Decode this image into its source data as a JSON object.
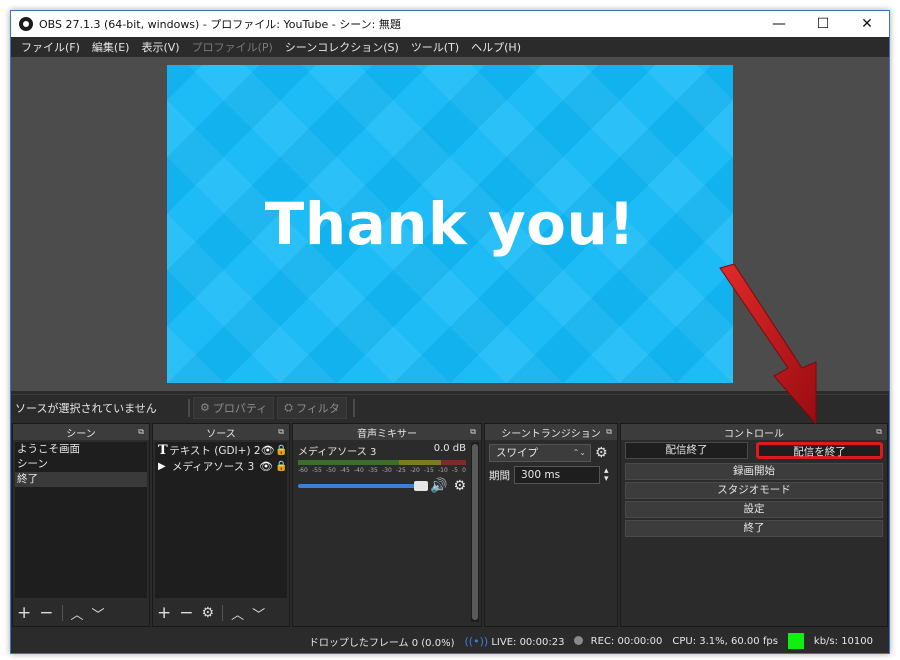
{
  "window": {
    "title": "OBS 27.1.3 (64-bit, windows) - プロファイル: YouTube - シーン: 無題",
    "controls": {
      "minimize": "—",
      "maximize": "☐",
      "close": "✕"
    }
  },
  "menu": [
    {
      "label": "ファイル(F)",
      "enabled": true
    },
    {
      "label": "編集(E)",
      "enabled": true
    },
    {
      "label": "表示(V)",
      "enabled": true
    },
    {
      "label": "プロファイル(P)",
      "enabled": false
    },
    {
      "label": "シーンコレクション(S)",
      "enabled": true
    },
    {
      "label": "ツール(T)",
      "enabled": true
    },
    {
      "label": "ヘルプ(H)",
      "enabled": true
    }
  ],
  "preview": {
    "text": "Thank you!",
    "background": "#12b8f7"
  },
  "source_toolbar": {
    "status": "ソースが選択されていません",
    "properties_label": "プロパティ",
    "filters_label": "フィルタ"
  },
  "scenes": {
    "title": "シーン",
    "items": [
      "ようこそ画面",
      "シーン",
      "終了"
    ],
    "selected_index": 2
  },
  "sources": {
    "title": "ソース",
    "items": [
      {
        "icon": "text-icon",
        "name": "テキスト (GDI+) 2"
      },
      {
        "icon": "media-icon",
        "name": "メディアソース 3"
      }
    ]
  },
  "mixer": {
    "title": "音声ミキサー",
    "channel": {
      "name": "メディアソース 3",
      "level": "0.0 dB"
    },
    "scale": [
      "-60",
      "-55",
      "-50",
      "-45",
      "-40",
      "-35",
      "-30",
      "-25",
      "-20",
      "-15",
      "-10",
      "-5",
      "0"
    ]
  },
  "transitions": {
    "title": "シーントランジション",
    "selected": "スワイプ",
    "duration_label": "期間",
    "duration_value": "300 ms"
  },
  "controls": {
    "title": "コントロール",
    "stop_stream_label": "配信終了",
    "end_stream_label": "配信を終了",
    "record_label": "録画開始",
    "studio_label": "スタジオモード",
    "settings_label": "設定",
    "exit_label": "終了"
  },
  "status": {
    "dropped": "ドロップしたフレーム 0 (0.0%)",
    "live": "LIVE: 00:00:23",
    "rec": "REC: 00:00:00",
    "cpu": "CPU: 3.1%, 60.00 fps",
    "bitrate": "kb/s: 10100",
    "bitrate_color": "#11ee11"
  },
  "colors": {
    "accent": "#3f7dd8",
    "annotation": "#c0121a",
    "panel": "#2b2b2b"
  }
}
